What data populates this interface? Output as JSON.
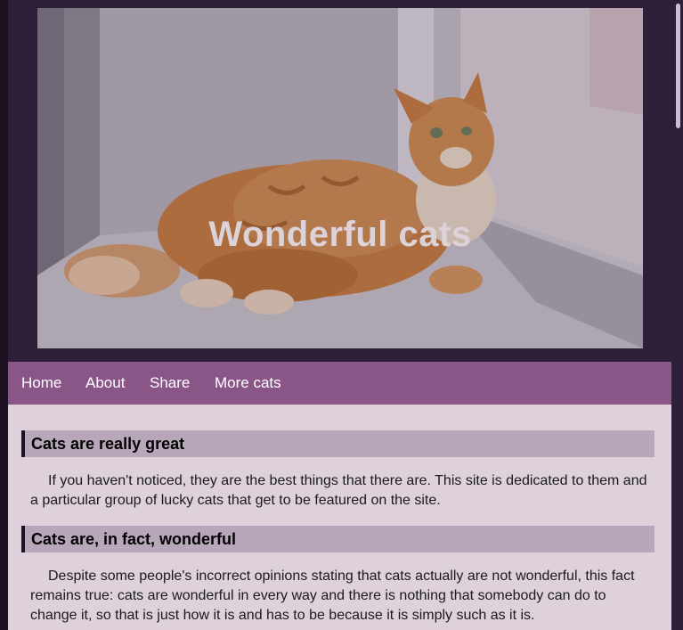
{
  "header": {
    "title": "Wonderful cats",
    "hero_image_icon": "cat-photo"
  },
  "nav": {
    "items": [
      {
        "label": "Home"
      },
      {
        "label": "About"
      },
      {
        "label": "Share"
      },
      {
        "label": "More cats"
      }
    ]
  },
  "sections": [
    {
      "heading": "Cats are really great",
      "body": "If you haven't noticed, they are the best things that there are. This site is dedicated to them and a particular group of lucky cats that get to be featured on the site."
    },
    {
      "heading": "Cats are, in fact, wonderful",
      "body": "Despite some people's incorrect opinions stating that cats actually are not wonderful, this fact remains true: cats are wonderful in every way and there is nothing that somebody can do to change it, so that is just how it is and has to be because it is simply such as it is."
    }
  ],
  "colors": {
    "page_background": "#2e1f38",
    "nav_background": "#8a5688",
    "content_background": "#ded1dc",
    "heading_background": "#b8a6ba",
    "heading_border": "#1e1226"
  }
}
